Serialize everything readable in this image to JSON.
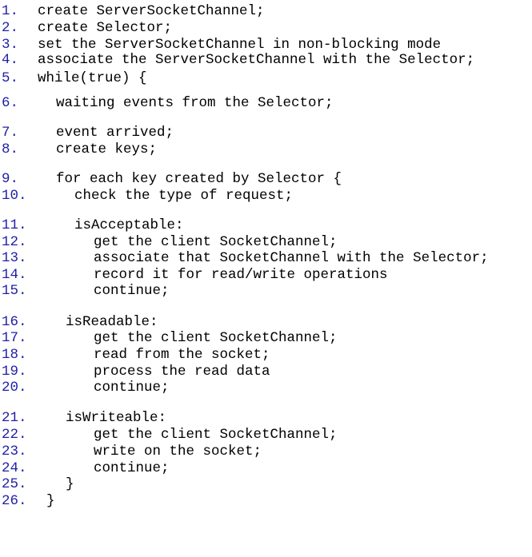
{
  "colors": {
    "line_number": "#1f1fa8",
    "code_text": "#000000",
    "background": "#ffffff"
  },
  "lines": [
    {
      "number": "1.",
      "text": "create ServerSocketChannel;"
    },
    {
      "number": "2.",
      "text": "create Selector;"
    },
    {
      "number": "3.",
      "text": "set the ServerSocketChannel in non-blocking mode"
    },
    {
      "number": "4.",
      "text": "associate the ServerSocketChannel with the Selector;"
    },
    {
      "number": "5.",
      "text": "while(true) {"
    },
    {
      "number": "6.",
      "text": "waiting events from the Selector;"
    },
    {
      "number": "7.",
      "text": "event arrived;"
    },
    {
      "number": "8.",
      "text": "create keys;"
    },
    {
      "number": "9.",
      "text": "for each key created by Selector {"
    },
    {
      "number": "10.",
      "text": "check the type of request;"
    },
    {
      "number": "11.",
      "text": "isAcceptable:"
    },
    {
      "number": "12.",
      "text": "get the client SocketChannel;"
    },
    {
      "number": "13.",
      "text": "associate that SocketChannel with the Selector;"
    },
    {
      "number": "14.",
      "text": "record it for read/write operations"
    },
    {
      "number": "15.",
      "text": "continue;"
    },
    {
      "number": "16.",
      "text": "isReadable:"
    },
    {
      "number": "17.",
      "text": "get the client SocketChannel;"
    },
    {
      "number": "18.",
      "text": "read from the socket;"
    },
    {
      "number": "19.",
      "text": "process the read data"
    },
    {
      "number": "20.",
      "text": "continue;"
    },
    {
      "number": "21.",
      "text": "isWriteable:"
    },
    {
      "number": "22.",
      "text": "get the client SocketChannel;"
    },
    {
      "number": "23.",
      "text": "write on the socket;"
    },
    {
      "number": "24.",
      "text": "continue;"
    },
    {
      "number": "25.",
      "text": "}"
    },
    {
      "number": "26.",
      "text": "}"
    }
  ]
}
